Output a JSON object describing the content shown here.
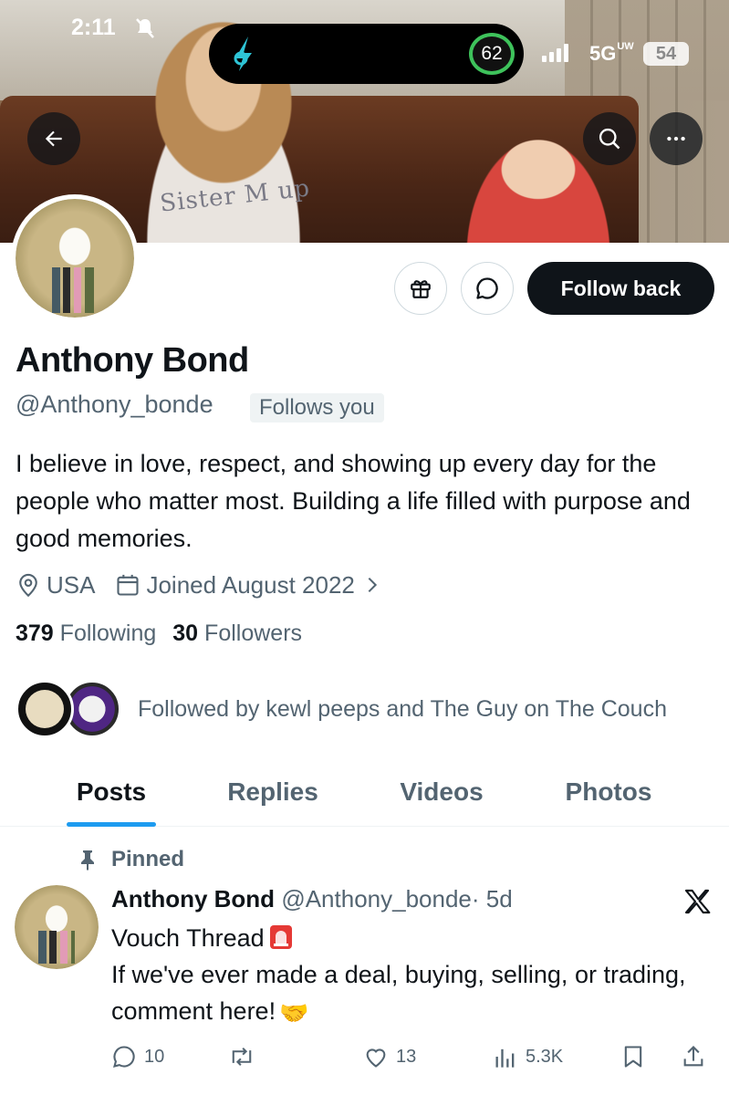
{
  "status_bar": {
    "time": "2:11",
    "island_badge": "62",
    "network": "5G",
    "network_sup": "UW",
    "battery": "54"
  },
  "banner": {
    "shirt_text": "Sister M up"
  },
  "profile": {
    "name": "Anthony Bond",
    "handle": "@Anthony_bonde",
    "follows_you": "Follows you",
    "bio": "I believe in love, respect, and showing up every day for the people who matter most. Building a life filled with purpose and good memories.",
    "location": "USA",
    "joined": "Joined August 2022",
    "following_count": "379",
    "following_label": "Following",
    "followers_count": "30",
    "followers_label": "Followers",
    "followed_by": "Followed by kewl peeps and The Guy on The Couch"
  },
  "actions": {
    "follow_label": "Follow back"
  },
  "tabs": [
    {
      "label": "Posts",
      "active": true
    },
    {
      "label": "Replies",
      "active": false
    },
    {
      "label": "Videos",
      "active": false
    },
    {
      "label": "Photos",
      "active": false
    }
  ],
  "pinned_post": {
    "pinned_label": "Pinned",
    "author": "Anthony Bond",
    "handle": "@Anthony_bonde",
    "time": "· 5d",
    "line1": "Vouch Thread",
    "line2": "If we've ever made a deal, buying, selling, or trading, comment here!",
    "replies": "10",
    "likes": "13",
    "views": "5.3K"
  },
  "colors": {
    "text_primary": "#0f1419",
    "text_secondary": "#536471",
    "accent": "#1d9bf0",
    "button_dark": "#0f1419"
  }
}
